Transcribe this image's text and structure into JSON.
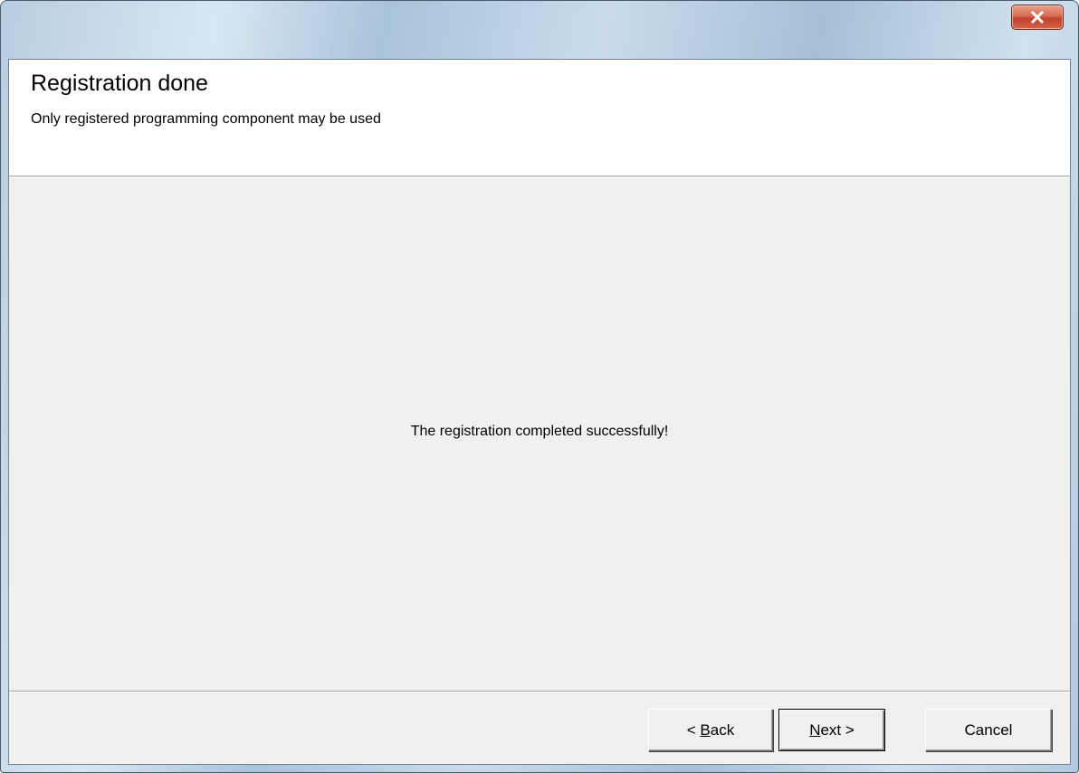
{
  "window": {
    "close_icon": "close-icon"
  },
  "header": {
    "title": "Registration done",
    "subtitle": "Only registered programming component may be used"
  },
  "main": {
    "message": "The registration completed successfully!"
  },
  "footer": {
    "back": {
      "prefix": "< ",
      "mnemonic": "B",
      "rest": "ack"
    },
    "next": {
      "mnemonic": "N",
      "rest": "ext >"
    },
    "cancel": "Cancel"
  },
  "colors": {
    "close_button": "#c2412a",
    "panel_background": "#f0f0f0",
    "header_background": "#ffffff"
  }
}
